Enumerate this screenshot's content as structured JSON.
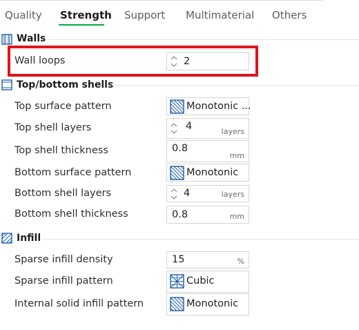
{
  "tabs": [
    {
      "label": "Quality",
      "active": false
    },
    {
      "label": "Strength",
      "active": true
    },
    {
      "label": "Support",
      "active": false
    },
    {
      "label": "Multimaterial",
      "active": false
    },
    {
      "label": "Others",
      "active": false
    }
  ],
  "sections": {
    "walls": {
      "title": "Walls",
      "icon": "walls-icon",
      "wall_loops": {
        "label": "Wall loops",
        "value": "2"
      }
    },
    "top_bottom": {
      "title": "Top/bottom shells",
      "icon": "shells-icon",
      "top_surface_pattern": {
        "label": "Top surface pattern",
        "value": "Monotonic ...",
        "icon": "monotonic-pattern-icon"
      },
      "top_shell_layers": {
        "label": "Top shell layers",
        "value": "4",
        "unit": "layers"
      },
      "top_shell_thickness": {
        "label": "Top shell thickness",
        "value": "0.8",
        "unit": "mm"
      },
      "bottom_surface_pattern": {
        "label": "Bottom surface pattern",
        "value": "Monotonic",
        "icon": "monotonic-pattern-icon"
      },
      "bottom_shell_layers": {
        "label": "Bottom shell layers",
        "value": "4",
        "unit": "layers"
      },
      "bottom_shell_thickness": {
        "label": "Bottom shell thickness",
        "value": "0.8",
        "unit": "mm"
      }
    },
    "infill": {
      "title": "Infill",
      "icon": "infill-icon",
      "sparse_infill_density": {
        "label": "Sparse infill density",
        "value": "15",
        "unit": "%"
      },
      "sparse_infill_pattern": {
        "label": "Sparse infill pattern",
        "value": "Cubic",
        "icon": "cubic-pattern-icon"
      },
      "internal_solid_infill_pattern": {
        "label": "Internal solid infill pattern",
        "value": "Monotonic",
        "icon": "monotonic-pattern-icon"
      }
    }
  },
  "colors": {
    "accent": "#00ae42",
    "highlight_box": "#e0141b",
    "icon_blue": "#1f5fa8"
  }
}
